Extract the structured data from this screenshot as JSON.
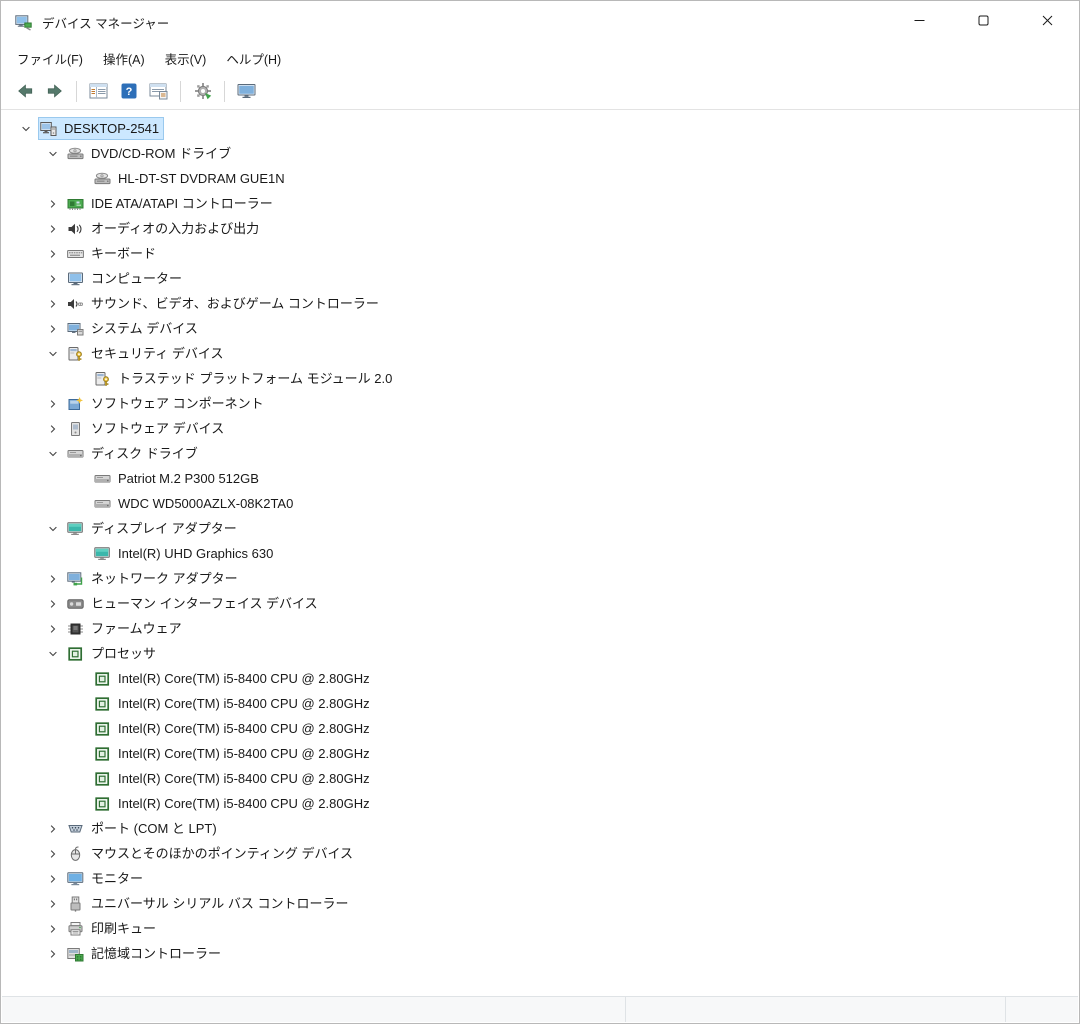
{
  "window": {
    "title": "デバイス マネージャー",
    "app_icon": "device-manager",
    "controls": [
      {
        "icon": "minimize",
        "name": "minimize-button"
      },
      {
        "icon": "maximize",
        "name": "maximize-button"
      },
      {
        "icon": "close",
        "name": "close-button"
      }
    ]
  },
  "colors": {
    "selection_background": "#cce8ff",
    "selection_border": "#9ac9ee",
    "titlebar_background": "#ffffff",
    "window_background": "#ffffff",
    "statusbar_background": "#f7f8f9"
  },
  "menu": {
    "items": [
      {
        "label": "ファイル(F)"
      },
      {
        "label": "操作(A)"
      },
      {
        "label": "表示(V)"
      },
      {
        "label": "ヘルプ(H)"
      }
    ]
  },
  "toolbar": {
    "buttons": [
      {
        "icon": "back-arrow",
        "name": "back-button"
      },
      {
        "icon": "forward-arrow",
        "name": "forward-button"
      },
      {
        "separator": true
      },
      {
        "icon": "console-window",
        "name": "show-console-tree-button"
      },
      {
        "icon": "help",
        "name": "help-button"
      },
      {
        "icon": "properties-window",
        "name": "properties-button"
      },
      {
        "separator": true
      },
      {
        "icon": "scan-hardware",
        "name": "scan-hardware-changes-button"
      },
      {
        "separator": true
      },
      {
        "icon": "remote-monitor",
        "name": "device-view-button"
      }
    ]
  },
  "tree": {
    "items": [
      {
        "level": 0,
        "state": "expanded",
        "icon": "computer-root",
        "label": "DESKTOP-2541",
        "selected": true
      },
      {
        "level": 1,
        "state": "expanded",
        "icon": "dvd-drive",
        "label": "DVD/CD-ROM ドライブ"
      },
      {
        "level": 2,
        "state": "leaf",
        "icon": "dvd-drive",
        "label": "HL-DT-ST DVDRAM GUE1N"
      },
      {
        "level": 1,
        "state": "collapsed",
        "icon": "ide-controller",
        "label": "IDE ATA/ATAPI コントローラー"
      },
      {
        "level": 1,
        "state": "collapsed",
        "icon": "audio-io",
        "label": "オーディオの入力および出力"
      },
      {
        "level": 1,
        "state": "collapsed",
        "icon": "keyboard",
        "label": "キーボード"
      },
      {
        "level": 1,
        "state": "collapsed",
        "icon": "computer-device",
        "label": "コンピューター"
      },
      {
        "level": 1,
        "state": "collapsed",
        "icon": "sound-video-game",
        "label": "サウンド、ビデオ、およびゲーム コントローラー"
      },
      {
        "level": 1,
        "state": "collapsed",
        "icon": "system-device",
        "label": "システム デバイス"
      },
      {
        "level": 1,
        "state": "expanded",
        "icon": "security-device",
        "label": "セキュリティ デバイス"
      },
      {
        "level": 2,
        "state": "leaf",
        "icon": "security-device",
        "label": "トラステッド プラットフォーム モジュール 2.0"
      },
      {
        "level": 1,
        "state": "collapsed",
        "icon": "software-component",
        "label": "ソフトウェア コンポーネント"
      },
      {
        "level": 1,
        "state": "collapsed",
        "icon": "software-device",
        "label": "ソフトウェア デバイス"
      },
      {
        "level": 1,
        "state": "expanded",
        "icon": "disk-drive",
        "label": "ディスク ドライブ"
      },
      {
        "level": 2,
        "state": "leaf",
        "icon": "disk-drive",
        "label": "Patriot M.2 P300 512GB"
      },
      {
        "level": 2,
        "state": "leaf",
        "icon": "disk-drive",
        "label": "WDC WD5000AZLX-08K2TA0"
      },
      {
        "level": 1,
        "state": "expanded",
        "icon": "display-adapter",
        "label": "ディスプレイ アダプター"
      },
      {
        "level": 2,
        "state": "leaf",
        "icon": "display-adapter",
        "label": "Intel(R) UHD Graphics 630"
      },
      {
        "level": 1,
        "state": "collapsed",
        "icon": "network-adapter",
        "label": "ネットワーク アダプター"
      },
      {
        "level": 1,
        "state": "collapsed",
        "icon": "hid-device",
        "label": "ヒューマン インターフェイス デバイス"
      },
      {
        "level": 1,
        "state": "collapsed",
        "icon": "firmware",
        "label": "ファームウェア"
      },
      {
        "level": 1,
        "state": "expanded",
        "icon": "processor",
        "label": "プロセッサ"
      },
      {
        "level": 2,
        "state": "leaf",
        "icon": "processor",
        "label": "Intel(R) Core(TM) i5-8400 CPU @ 2.80GHz"
      },
      {
        "level": 2,
        "state": "leaf",
        "icon": "processor",
        "label": "Intel(R) Core(TM) i5-8400 CPU @ 2.80GHz"
      },
      {
        "level": 2,
        "state": "leaf",
        "icon": "processor",
        "label": "Intel(R) Core(TM) i5-8400 CPU @ 2.80GHz"
      },
      {
        "level": 2,
        "state": "leaf",
        "icon": "processor",
        "label": "Intel(R) Core(TM) i5-8400 CPU @ 2.80GHz"
      },
      {
        "level": 2,
        "state": "leaf",
        "icon": "processor",
        "label": "Intel(R) Core(TM) i5-8400 CPU @ 2.80GHz"
      },
      {
        "level": 2,
        "state": "leaf",
        "icon": "processor",
        "label": "Intel(R) Core(TM) i5-8400 CPU @ 2.80GHz"
      },
      {
        "level": 1,
        "state": "collapsed",
        "icon": "ports",
        "label": "ポート (COM と LPT)"
      },
      {
        "level": 1,
        "state": "collapsed",
        "icon": "mouse",
        "label": "マウスとそのほかのポインティング デバイス"
      },
      {
        "level": 1,
        "state": "collapsed",
        "icon": "monitor",
        "label": "モニター"
      },
      {
        "level": 1,
        "state": "collapsed",
        "icon": "usb-controller",
        "label": "ユニバーサル シリアル バス コントローラー"
      },
      {
        "level": 1,
        "state": "collapsed",
        "icon": "print-queue",
        "label": "印刷キュー"
      },
      {
        "level": 1,
        "state": "collapsed",
        "icon": "storage-controller",
        "label": "記憶域コントローラー"
      }
    ]
  },
  "statusbar": {
    "left_text": "",
    "mid_text": "",
    "right_text": ""
  }
}
